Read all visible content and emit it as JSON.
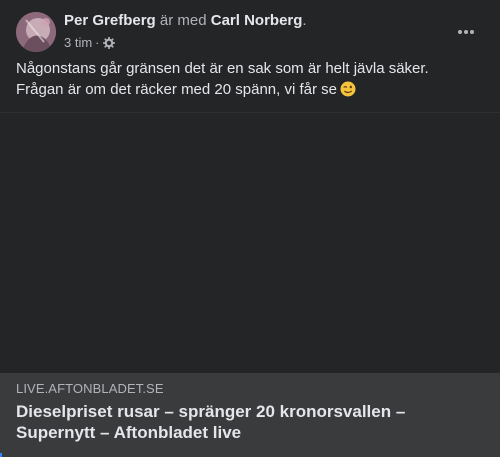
{
  "post": {
    "author_name": "Per Grefberg",
    "with_text": " är med ",
    "tagged_name": "Carl Norberg",
    "end_punct": ".",
    "timestamp": "3 tim",
    "separator": "·",
    "audience_icon": "gear-icon",
    "more_icon": "more-horizontal-icon",
    "text_line1": "Någonstans går gränsen det är en sak som är helt jävla säker.",
    "text_line2": "Frågan är om det räcker med 20 spänn, vi får se",
    "emoji": "winking-face-emoji"
  },
  "link_preview": {
    "domain": "LIVE.AFTONBLADET.SE",
    "title": "Dieselpriset rusar – spränger 20 kronorsvallen – Supernytt – Aftonbladet live"
  },
  "colors": {
    "card_background": "#242526",
    "link_background": "#3a3b3c",
    "primary_text": "#e4e6eb",
    "secondary_text": "#b0b3b8",
    "accent": "#2d88ff"
  }
}
